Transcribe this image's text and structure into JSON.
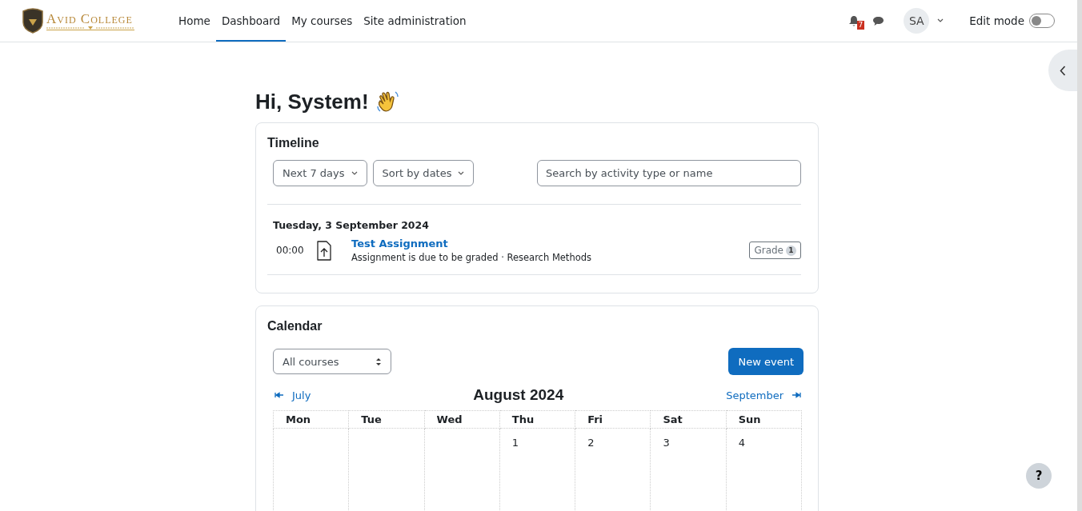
{
  "brand": {
    "name": "Avid College"
  },
  "nav": [
    {
      "label": "Home",
      "selected": false
    },
    {
      "label": "Dashboard",
      "selected": true
    },
    {
      "label": "My courses",
      "selected": false
    },
    {
      "label": "Site administration",
      "selected": false
    }
  ],
  "notifications": {
    "count": "7"
  },
  "user": {
    "initials": "SA"
  },
  "edit_mode": {
    "label": "Edit mode",
    "on": false
  },
  "greeting": "Hi, System!",
  "timeline": {
    "title": "Timeline",
    "filter": "Next 7 days",
    "sort": "Sort by dates",
    "search": {
      "placeholder": "Search by activity type or name"
    },
    "date": "Tuesday, 3 September 2024",
    "events": [
      {
        "time": "00:00",
        "title": "Test Assignment",
        "detail": "Assignment is due to be graded · Research Methods",
        "action": "Grade",
        "count": "1"
      }
    ]
  },
  "calendar": {
    "title": "Calendar",
    "course_select": "All courses",
    "new_event": "New event",
    "prev": "July",
    "month": "August 2024",
    "next": "September",
    "weekdays": [
      "Mon",
      "Tue",
      "Wed",
      "Thu",
      "Fri",
      "Sat",
      "Sun"
    ],
    "weeks": [
      [
        "1",
        "2",
        "3",
        "4"
      ]
    ]
  },
  "help": "?"
}
